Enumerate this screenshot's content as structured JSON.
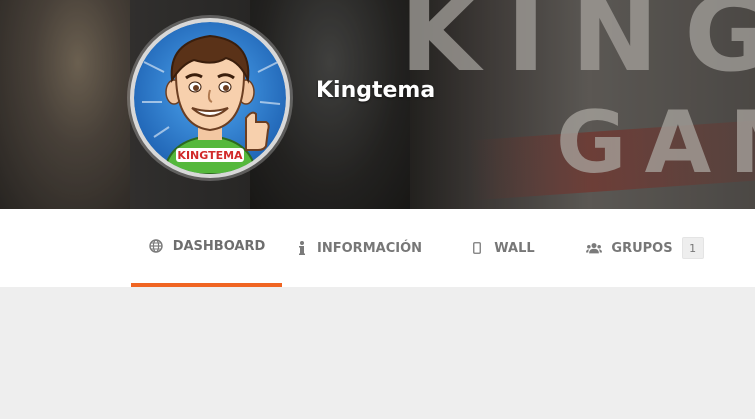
{
  "profile": {
    "username": "Kingtema",
    "avatar_icon": "cartoon-avatar",
    "cover_text_line1": "KING",
    "cover_text_line2": "GAM"
  },
  "tabs": [
    {
      "label": "DASHBOARD",
      "icon": "globe-icon",
      "active": true
    },
    {
      "label": "INFORMACIÓN",
      "icon": "info-icon",
      "active": false
    },
    {
      "label": "WALL",
      "icon": "mobile-icon",
      "active": false
    },
    {
      "label": "GRUPOS",
      "icon": "users-icon",
      "active": false,
      "count": "1"
    }
  ],
  "colors": {
    "accent": "#f06522",
    "page_bg": "#eeeeee",
    "nav_bg": "#ffffff"
  }
}
